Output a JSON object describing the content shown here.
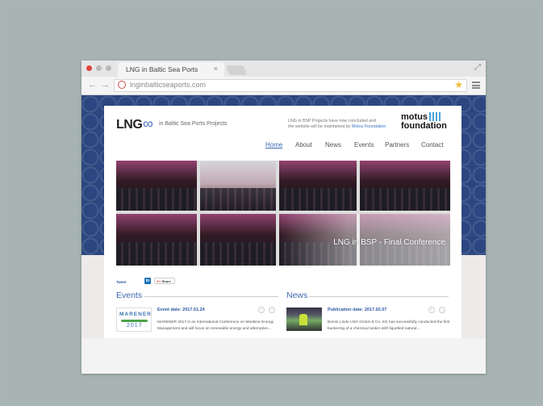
{
  "browser": {
    "tab_title": "LNG in Baltic Sea Ports",
    "tab_close": "×",
    "url": "lnginbalticseaports.com",
    "bookmark_star": "★",
    "back_glyph": "←",
    "forward_glyph": "→",
    "expand_glyph": "⤢"
  },
  "site": {
    "logo_text": "LNG",
    "logo_symbol": "∞",
    "logo_subtitle": "in Baltic Sea Ports Projects",
    "notice_line1": "LNG in BSP Projects have now concluded and",
    "notice_line2": "the website will be maintained by",
    "notice_link": "Motus Foundation",
    "partner_line1": "motus",
    "partner_line2": "foundation"
  },
  "menu": {
    "home": "Home",
    "about": "About",
    "news": "News",
    "events": "Events",
    "partners": "Partners",
    "contact": "Contact"
  },
  "gallery": {
    "caption": "LNG in BSP - Final Conference"
  },
  "social": {
    "tweet": "Tweet",
    "linkedin": "in",
    "gplus": "G+",
    "share": "Share"
  },
  "events": {
    "title": "Events",
    "thumb_line1": "MARENER",
    "thumb_line2": "2017",
    "item_title": "Event date: 2017.01.24",
    "item_text": "MARENER 2017 is an International Conference on Maritime Energy Management and will focus on renewable energy and alternative...",
    "prev": "‹",
    "next": "›"
  },
  "news": {
    "title": "News",
    "item_title": "Publication date: 2017.02.07",
    "item_text": "Bomin Linde LNG GmbH & Co. KG has successfully conducted the first bunkering of a chemical tanker with liquefied natural...",
    "prev": "‹",
    "next": "›"
  },
  "colors": {
    "backdrop": "#a9b5b4",
    "site_blue": "#2a447f",
    "link_blue": "#3b66b0",
    "close_red": "#e0443e",
    "star_yellow": "#f1b93a"
  }
}
